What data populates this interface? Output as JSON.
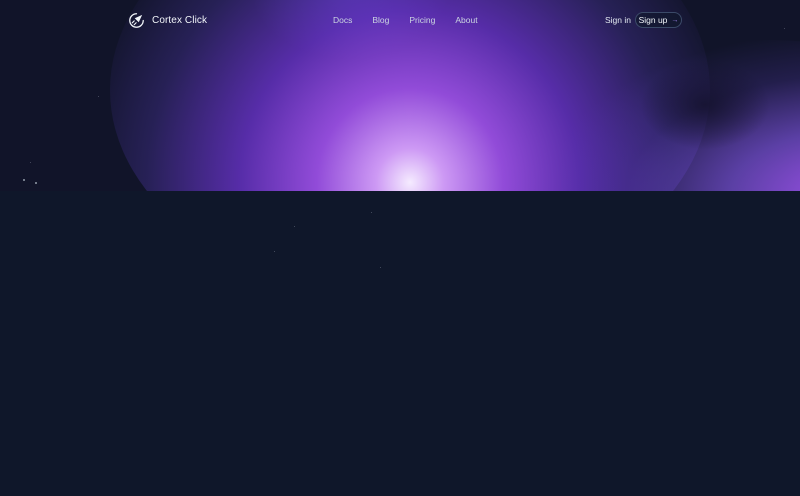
{
  "brand": {
    "name": "Cortex Click",
    "logo_icon": "rocket-icon"
  },
  "nav": {
    "items": [
      {
        "label": "Docs"
      },
      {
        "label": "Blog"
      },
      {
        "label": "Pricing"
      },
      {
        "label": "About"
      }
    ]
  },
  "auth": {
    "sign_in_label": "Sign in",
    "sign_up_label": "Sign up",
    "sign_up_icon": "arrow-right-icon"
  },
  "colors": {
    "background": "#0f172a",
    "accent": "#a855f7",
    "text": "#f1f5f9"
  }
}
